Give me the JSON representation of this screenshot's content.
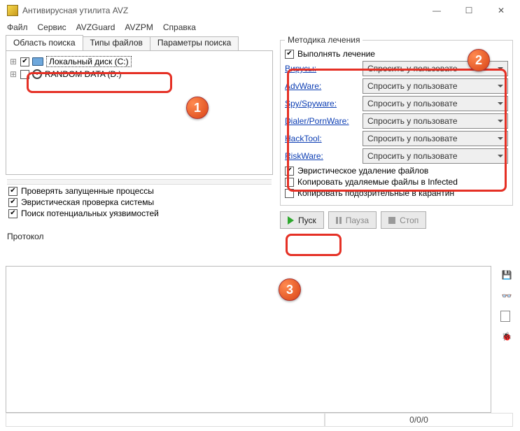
{
  "window": {
    "title": "Антивирусная утилита AVZ"
  },
  "menu": {
    "file": "Файл",
    "service": "Сервис",
    "guard": "AVZGuard",
    "pm": "AVZPM",
    "help": "Справка"
  },
  "tabs_left": {
    "t1": "Область поиска",
    "t2": "Типы файлов",
    "t3": "Параметры поиска"
  },
  "tree": {
    "disk_c": "Локальный диск (C:)",
    "cdrom": "RANDOM DATA (D:)"
  },
  "left_checks": {
    "c1": "Проверять запущенные процессы",
    "c2": "Эвристическая проверка системы",
    "c3": "Поиск потенциальных уязвимостей"
  },
  "treat": {
    "legend": "Методика лечения",
    "enable": "Выполнять лечение",
    "rows": {
      "virus": "Вирусы:",
      "adware": "AdvWare:",
      "spy": "Spy/Spyware:",
      "dialer": "Dialer/PornWare:",
      "hacktool": "HackTool:",
      "riskware": "RiskWare:"
    },
    "combo_val": "Спросить у пользовате",
    "h1": "Эвристическое удаление файлов",
    "h2": "Копировать удаляемые файлы в Infected",
    "h3": "Копировать подозрительные в карантин"
  },
  "buttons": {
    "start": "Пуск",
    "pause": "Пауза",
    "stop": "Стоп"
  },
  "protocol_label": "Протокол",
  "status": {
    "counts": "0/0/0"
  },
  "badges": {
    "b1": "1",
    "b2": "2",
    "b3": "3"
  }
}
